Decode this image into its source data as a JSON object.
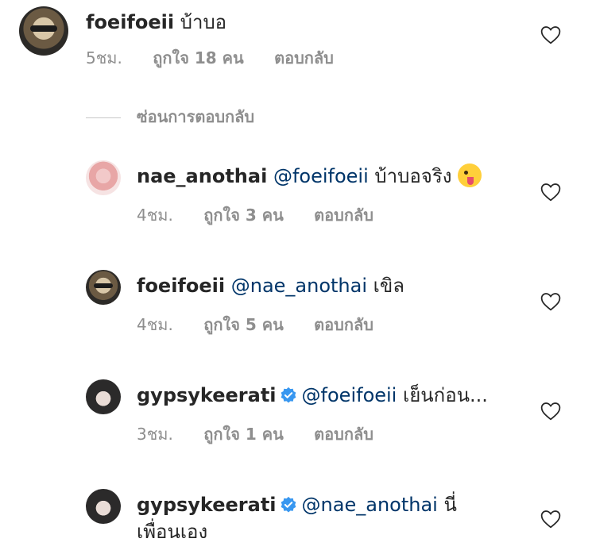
{
  "comments": [
    {
      "username": "foeifoeii",
      "text": "บ้าบอ",
      "time": "5ชม.",
      "likes": "ถูกใจ 18 คน",
      "reply": "ตอบกลับ"
    },
    {
      "username": "nae_anothai",
      "mention": "@foeifoeii",
      "text": "บ้าบอจริง",
      "emoji": "winking-face-with-tongue",
      "time": "4ชม.",
      "likes": "ถูกใจ 3 คน",
      "reply": "ตอบกลับ"
    },
    {
      "username": "foeifoeii",
      "mention": "@nae_anothai",
      "text": "เขิล",
      "time": "4ชม.",
      "likes": "ถูกใจ 5 คน",
      "reply": "ตอบกลับ"
    },
    {
      "username": "gypsykeerati",
      "mention": "@foeifoeii",
      "text": "เย็นก่อน...",
      "time": "3ชม.",
      "likes": "ถูกใจ 1 คน",
      "reply": "ตอบกลับ"
    },
    {
      "username": "gypsykeerati",
      "mention": "@nae_anothai",
      "text": "นี่",
      "text_line2": "เพื่อนเอง"
    }
  ],
  "hide_replies_label": "ซ่อนการตอบกลับ",
  "colors": {
    "mention": "#003569",
    "secondary_text": "#8e8e8e",
    "verified": "#3897f0"
  },
  "icons": {
    "like": "heart-outline-icon",
    "verified": "verified-badge-icon"
  }
}
